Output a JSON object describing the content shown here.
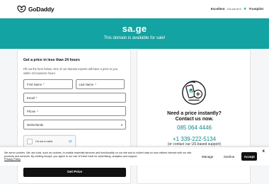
{
  "header": {
    "logo_text": "GoDaddy",
    "rating_excellent": "Excellent",
    "rating_score": "4.6 out of 5",
    "rating_brand": "Trustpilot"
  },
  "hero": {
    "domain": "sa.ge",
    "subtitle": "This domain is available for sale!"
  },
  "form": {
    "title": "Get a price in less than 24 hours",
    "description": "Fill out the form below. One of our domain experts will have a price to you within 24 business hours.",
    "first_name": "First Name",
    "last_name": "Last Name",
    "email": "Email",
    "phone": "Phone",
    "country": "Netherlands",
    "required_mark": "*",
    "captcha_label": "I'm not a robot",
    "submit": "Get Price"
  },
  "contact": {
    "heading_line1": "Need a price instantly?",
    "heading_line2": "Contact us now.",
    "phone_local": "085 064 4446",
    "phone_us": "+1 339-222-5134",
    "phone_us_note": "(or contact our US based support)"
  },
  "cookie": {
    "text": "We serve cookies. We use tools, such as cookies, to enable essential services and functionality on our site and to collect data on how visitors interact with our site, products and services. By clicking Accept, you agree to our use of these tools for advertising, analytics and support.",
    "policy_link": "Privacy Policy",
    "manage": "Manage",
    "decline": "Decline",
    "accept": "Accept",
    "close": "x"
  },
  "colors": {
    "accent": "#14a3a3",
    "phone": "#0e8a8a",
    "trustpilot": "#00b67a"
  }
}
